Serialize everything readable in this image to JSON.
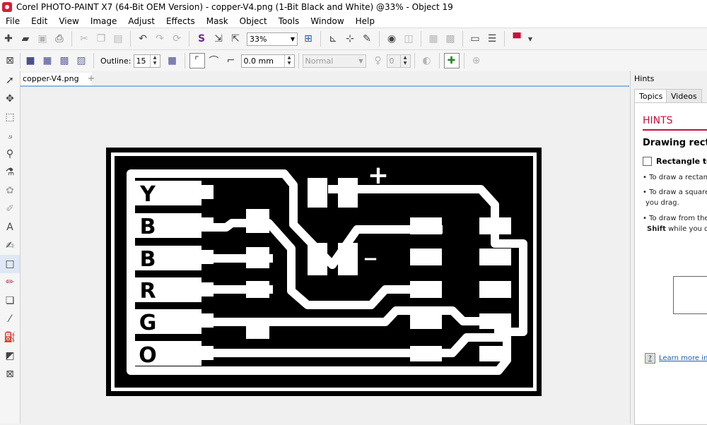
{
  "window": {
    "title": "Corel PHOTO-PAINT X7 (64-Bit OEM Version) - copper-V4.png (1-Bit Black and White) @33% - Object 19"
  },
  "menu": [
    "File",
    "Edit",
    "View",
    "Image",
    "Adjust",
    "Effects",
    "Mask",
    "Object",
    "Tools",
    "Window",
    "Help"
  ],
  "toolbar": {
    "zoom": "33%"
  },
  "property_bar": {
    "outline_label": "Outline:",
    "outline_value": "15",
    "offset_value": "0.0 mm",
    "merge_mode": "Normal",
    "transparency_value": "0"
  },
  "document": {
    "tab_label": "copper-V4.png",
    "add_tab": "+"
  },
  "pcb": {
    "labels": [
      "Y",
      "B",
      "B",
      "R",
      "G",
      "O"
    ],
    "plus_mark": "+",
    "minus_mark": "−"
  },
  "hints": {
    "panel_title": "Hints",
    "tabs": [
      "Topics",
      "Videos"
    ],
    "heading": "HINTS",
    "subheading": "Drawing rectangles",
    "tool_name": "Rectangle tool",
    "line1": "• To draw a rectangle",
    "line2": "• To draw a square,",
    "line2b": "  you drag.",
    "line3": "• To draw from the c",
    "line3b_bold": "Shift",
    "line3b_rest": " while you dra",
    "link": "Learn more in this"
  }
}
